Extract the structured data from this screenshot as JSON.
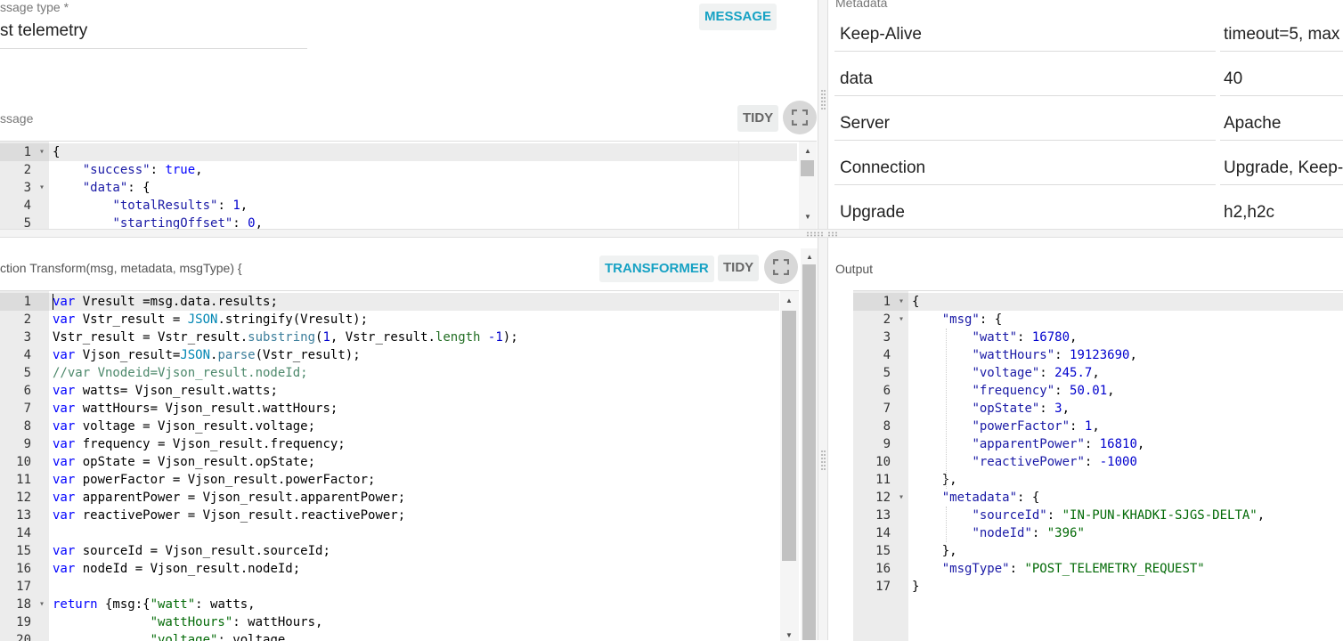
{
  "message_type": {
    "label": "ssage type *",
    "value": "st telemetry",
    "badge": "MESSAGE"
  },
  "message_panel": {
    "label": "ssage",
    "tidy": "TIDY",
    "lines": [
      {
        "n": "1",
        "fold": true
      },
      {
        "n": "2",
        "fold": false
      },
      {
        "n": "3",
        "fold": true
      },
      {
        "n": "4",
        "fold": false
      },
      {
        "n": "5",
        "fold": false
      }
    ]
  },
  "metadata": {
    "label": "Metadata",
    "rows": [
      {
        "key": "Keep-Alive",
        "value": "timeout=5, max"
      },
      {
        "key": "data",
        "value": "40"
      },
      {
        "key": "Server",
        "value": "Apache"
      },
      {
        "key": "Connection",
        "value": "Upgrade, Keep-"
      },
      {
        "key": "Upgrade",
        "value": "h2,h2c"
      }
    ]
  },
  "transform_panel": {
    "signature": "ction Transform(msg, metadata, msgType) {",
    "badge": "TRANSFORMER",
    "tidy": "TIDY",
    "line_numbers": [
      "1",
      "2",
      "3",
      "4",
      "5",
      "6",
      "7",
      "8",
      "9",
      "10",
      "11",
      "12",
      "13",
      "14",
      "15",
      "16",
      "17",
      "18",
      "19",
      "20"
    ]
  },
  "output_panel": {
    "label": "Output",
    "line_numbers": [
      "1",
      "2",
      "3",
      "4",
      "5",
      "6",
      "7",
      "8",
      "9",
      "10",
      "11",
      "12",
      "13",
      "14",
      "15",
      "16",
      "17"
    ]
  },
  "colors": {
    "accent": "#17a2c4",
    "keyword": "#0000ff",
    "string": "#036a07",
    "comment": "#236e24"
  },
  "icons": [
    "fullscreen-icon",
    "fold-arrow-icon",
    "scroll-up-icon",
    "scroll-down-icon",
    "drag-handle-icon"
  ]
}
